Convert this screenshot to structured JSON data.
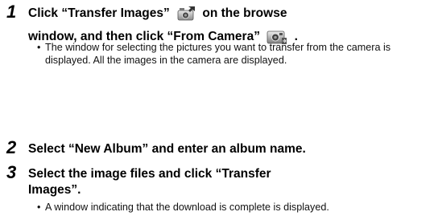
{
  "steps": [
    {
      "number": "1",
      "line1_part1": "Click “Transfer Images”",
      "line1_part2": "on the browse",
      "line2_part1": "window, and then click “From Camera”",
      "line2_part2": ".",
      "icon1": "transfer-images-icon",
      "icon2": "from-camera-icon",
      "note_bullet": "•",
      "note": "The window for selecting the pictures you want to transfer from the camera is displayed. All the images in the camera are displayed."
    },
    {
      "number": "2",
      "text": "Select “New Album” and enter an album name."
    },
    {
      "number": "3",
      "line1": "Select the image files and click “Transfer",
      "line2": "Images”.",
      "note_bullet": "•",
      "note": "A window indicating that the download is complete is displayed."
    }
  ]
}
